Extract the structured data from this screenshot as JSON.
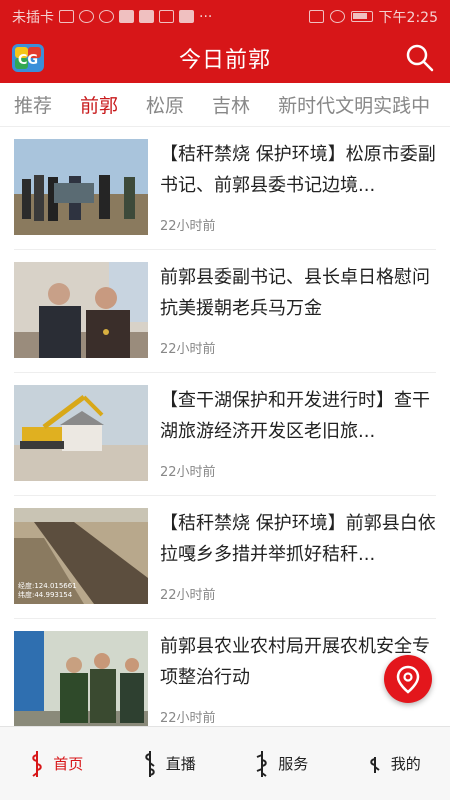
{
  "status_bar": {
    "carrier": "未插卡",
    "time": "下午2:25"
  },
  "header": {
    "title": "今日前郭"
  },
  "tabs": [
    {
      "label": "推荐"
    },
    {
      "label": "前郭"
    },
    {
      "label": "松原"
    },
    {
      "label": "吉林"
    },
    {
      "label": "新时代文明实践中"
    }
  ],
  "news": [
    {
      "title": "【秸秆禁烧 保护环境】松原市委副书记、前郭县委书记边境...",
      "time": "22小时前"
    },
    {
      "title": "前郭县委副书记、县长卓日格慰问抗美援朝老兵马万金",
      "time": "22小时前"
    },
    {
      "title": "【查干湖保护和开发进行时】查干湖旅游经济开发区老旧旅...",
      "time": "22小时前"
    },
    {
      "title": "【秸秆禁烧 保护环境】前郭县白依拉嘎乡多措并举抓好秸秆...",
      "time": "22小时前",
      "photo_caption_1": "经度:124.015661",
      "photo_caption_2": "纬度:44.993154"
    },
    {
      "title": "前郭县农业农村局开展农机安全专项整治行动",
      "time": "22小时前"
    }
  ],
  "bottom_nav": [
    {
      "label": "首页"
    },
    {
      "label": "直播"
    },
    {
      "label": "服务"
    },
    {
      "label": "我的"
    }
  ],
  "colors": {
    "brand_red": "#d71618",
    "active_tab": "#c81a1c"
  }
}
